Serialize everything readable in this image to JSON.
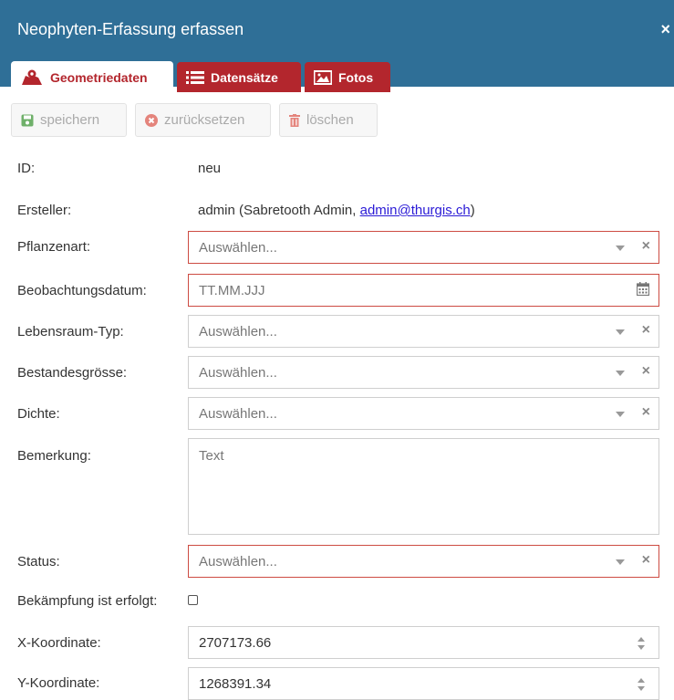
{
  "window": {
    "title": "Neophyten-Erfassung erfassen",
    "close_glyph": "×"
  },
  "tabs": [
    {
      "label": "Geometriedaten",
      "icon": "map-marker-icon",
      "active": true
    },
    {
      "label": "Datensätze",
      "icon": "list-icon",
      "active": false
    },
    {
      "label": "Fotos",
      "icon": "image-icon",
      "active": false
    }
  ],
  "toolbar": {
    "save_label": "speichern",
    "reset_label": "zurücksetzen",
    "delete_label": "löschen"
  },
  "form": {
    "id_label": "ID:",
    "id_value": "neu",
    "creator_label": "Ersteller:",
    "creator_prefix": "admin (Sabretooth Admin, ",
    "creator_email": "admin@thurgis.ch",
    "creator_suffix": ")",
    "plant_label": "Pflanzenart:",
    "plant_placeholder": "Auswählen...",
    "date_label": "Beobachtungsdatum:",
    "date_placeholder": "TT.MM.JJJ",
    "habitat_label": "Lebensraum-Typ:",
    "habitat_placeholder": "Auswählen...",
    "stock_label": "Bestandesgrösse:",
    "stock_placeholder": "Auswählen...",
    "density_label": "Dichte:",
    "density_placeholder": "Auswählen...",
    "remark_label": "Bemerkung:",
    "remark_placeholder": "Text",
    "status_label": "Status:",
    "status_placeholder": "Auswählen...",
    "control_label": "Bekämpfung ist erfolgt:",
    "x_label": "X-Koordinate:",
    "x_value": "2707173.66",
    "y_label": "Y-Koordinate:",
    "y_value": "1268391.34",
    "clear_glyph": "×"
  },
  "colors": {
    "header": "#2f6f97",
    "tab_red": "#b3262d",
    "required_border": "#cd4b42"
  }
}
